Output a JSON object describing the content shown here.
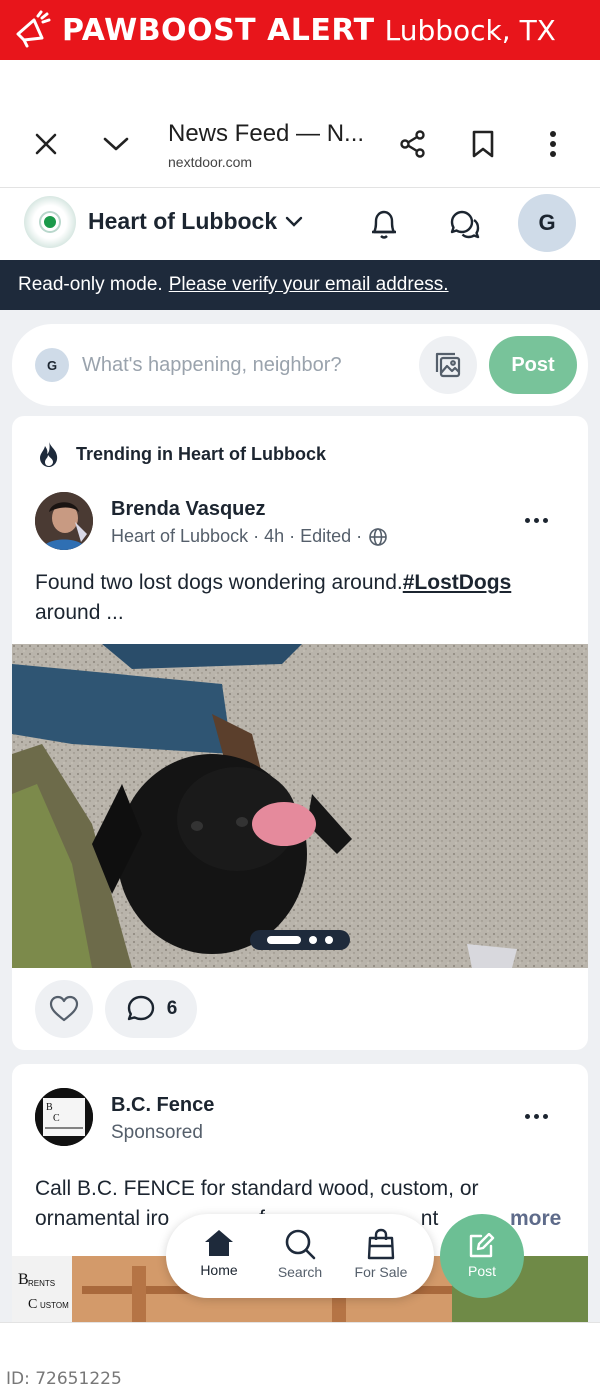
{
  "alert": {
    "title": "PAWBOOST ALERT",
    "location": "Lubbock, TX",
    "icon": "megaphone-icon",
    "color": "#e8151b"
  },
  "browser": {
    "page_title": "News Feed — N...",
    "domain": "nextdoor.com"
  },
  "header": {
    "neighborhood": "Heart of Lubbock",
    "avatar_initial": "G"
  },
  "readonly": {
    "text": "Read-only mode.",
    "link": "Please verify your email address."
  },
  "composer": {
    "avatar_initial": "G",
    "placeholder": "What's happening, neighbor?",
    "post_label": "Post"
  },
  "post1": {
    "trending": "Trending in Heart of Lubbock",
    "author": "Brenda Vasquez",
    "meta": "Heart of Lubbock · 4h · Edited ·",
    "text": "Found two lost dogs wondering around.",
    "hashtag": "#LostDogs",
    "text_cont": "around ...",
    "comment_count": "6",
    "image_count": 3,
    "image_index": 1
  },
  "post2": {
    "author": "B.C. Fence",
    "sponsored": "Sponsored",
    "text": "Call B.C. FENCE for standard wood, custom, or ornamental iro",
    "text_tail": "f",
    "text_tail2": "nt",
    "more": "more"
  },
  "nav": {
    "home": "Home",
    "search": "Search",
    "for_sale": "For Sale",
    "post": "Post"
  },
  "footer": {
    "id": "ID: 72651225"
  }
}
